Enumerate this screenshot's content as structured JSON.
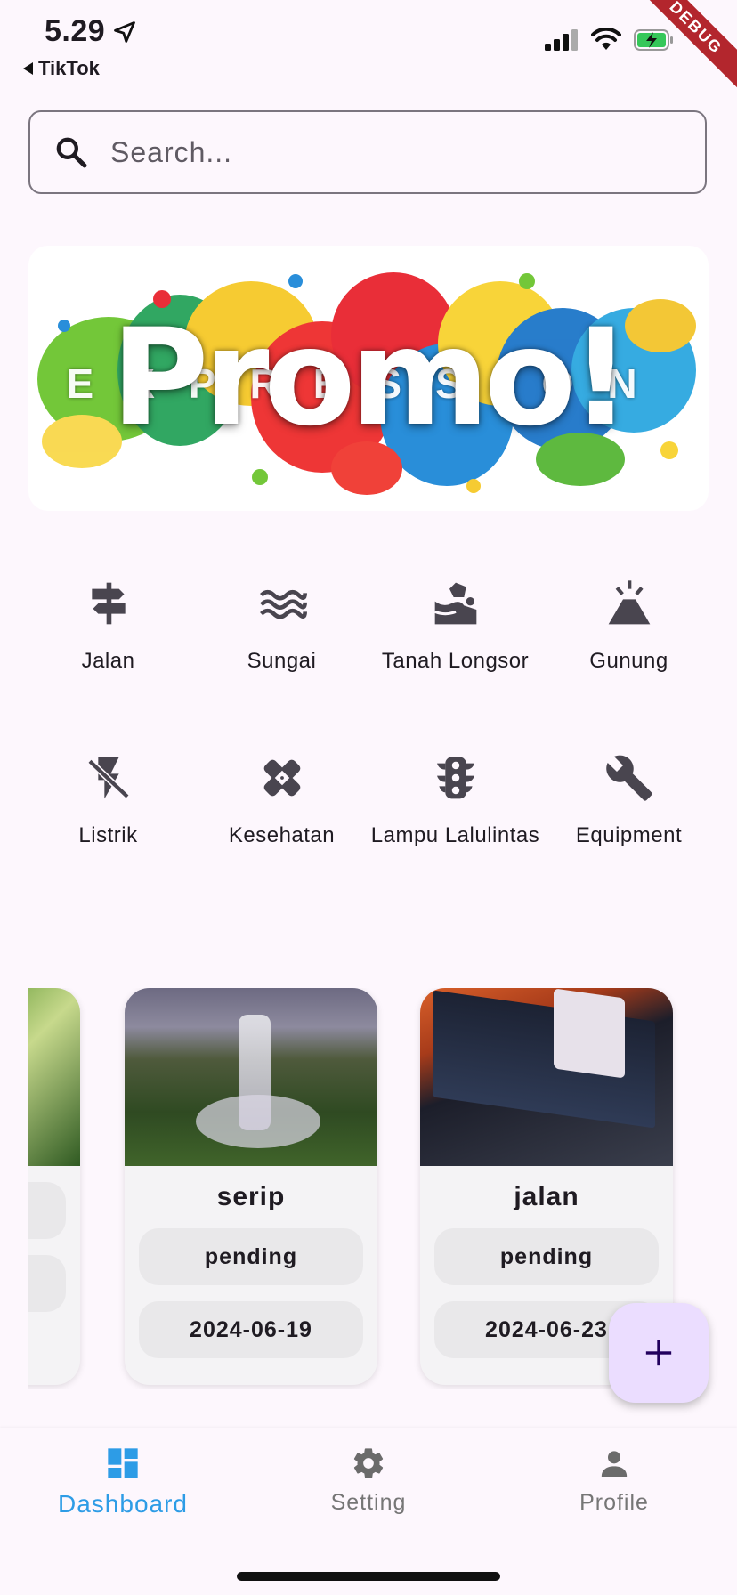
{
  "status_bar": {
    "time": "5.29",
    "back_app": "TikTok",
    "debug_label": "DEBUG"
  },
  "search": {
    "placeholder": "Search..."
  },
  "banner": {
    "text": "Promo!",
    "background_text": "EXPRESSION"
  },
  "categories": [
    {
      "label": "Jalan",
      "icon": "signpost-icon"
    },
    {
      "label": "Sungai",
      "icon": "waves-icon"
    },
    {
      "label": "Tanah Longsor",
      "icon": "landslide-icon"
    },
    {
      "label": "Gunung",
      "icon": "volcano-icon"
    },
    {
      "label": "Listrik",
      "icon": "flash-off-icon"
    },
    {
      "label": "Kesehatan",
      "icon": "healing-icon"
    },
    {
      "label": "Lampu Lalulintas",
      "icon": "traffic-light-icon"
    },
    {
      "label": "Equipment",
      "icon": "wrench-icon"
    }
  ],
  "cards": [
    {
      "title": "",
      "status": "",
      "date": ""
    },
    {
      "title": "serip",
      "status": "pending",
      "date": "2024-06-19"
    },
    {
      "title": "jalan",
      "status": "pending",
      "date": "2024-06-23"
    }
  ],
  "bottom_nav": [
    {
      "label": "Dashboard",
      "icon": "dashboard-icon",
      "active": true
    },
    {
      "label": "Setting",
      "icon": "gear-icon",
      "active": false
    },
    {
      "label": "Profile",
      "icon": "person-icon",
      "active": false
    }
  ],
  "colors": {
    "accent": "#2d9ce6",
    "fab": "#ebddff",
    "background": "#fdf7fd"
  }
}
